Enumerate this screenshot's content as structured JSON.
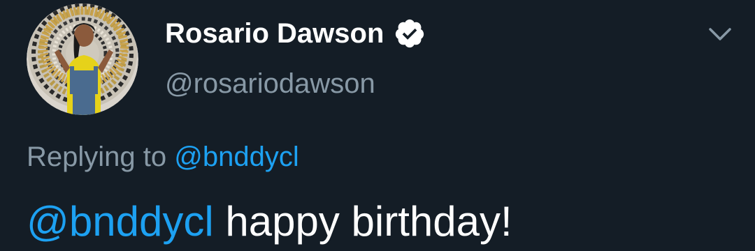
{
  "tweet": {
    "display_name": "Rosario Dawson",
    "handle": "@rosariodawson",
    "verified_icon": "verified-badge-icon",
    "menu_icon": "chevron-down-icon",
    "avatar_icon": "profile-avatar",
    "replying_prefix": "Replying to",
    "replying_to": "@bnddycl",
    "text_mention": "@bnddycl",
    "text_body": "happy birthday!"
  },
  "colors": {
    "background": "#141d26",
    "primary_text": "#ffffff",
    "secondary_text": "#8899a6",
    "link": "#1da1f2"
  }
}
